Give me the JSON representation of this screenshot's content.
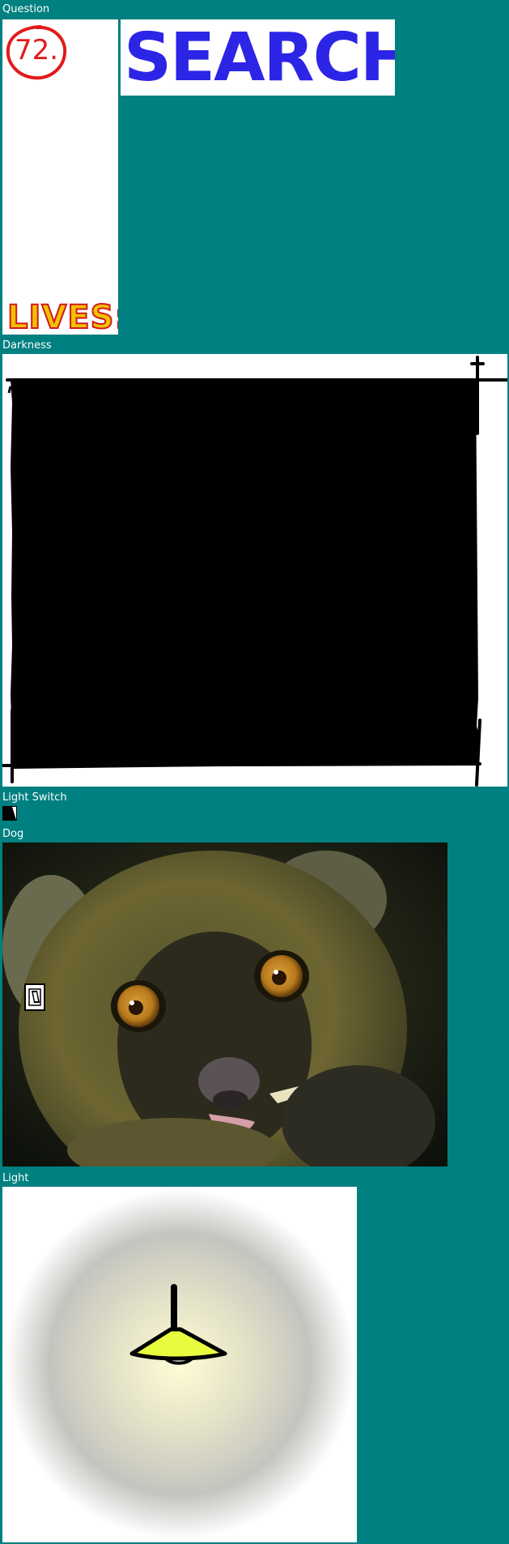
{
  "sections": {
    "question": "Question",
    "darkness": "Darkness",
    "light_switch": "Light Switch",
    "dog": "Dog",
    "light": "Light"
  },
  "question_number": "72.",
  "lives_label": "LIVES:",
  "search_title": "SEARCH!",
  "icons": {
    "switch": "light-switch-icon",
    "lamp": "ceiling-lamp-icon"
  },
  "colors": {
    "background": "#008080",
    "question_number": "#e21b1b",
    "lives_fill": "#f2c200",
    "lives_outline": "#d11a1a",
    "search_title": "#2d25e6",
    "lamp_shade": "#e9fb3f"
  }
}
